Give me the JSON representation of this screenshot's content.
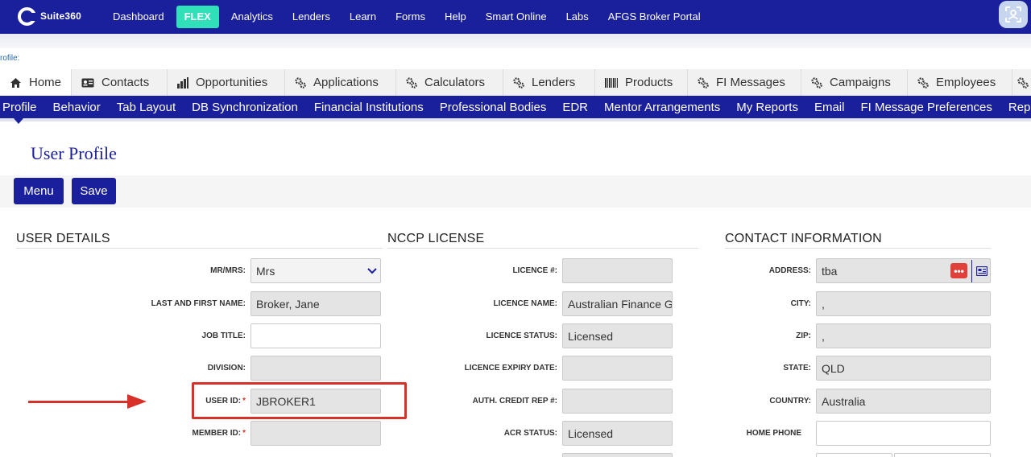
{
  "app": {
    "logo_text": "Suite360"
  },
  "topnav": {
    "items": [
      "Dashboard",
      "FLEX",
      "Analytics",
      "Lenders",
      "Learn",
      "Forms",
      "Help",
      "Smart Online",
      "Labs",
      "AFGS Broker Portal"
    ],
    "active": "FLEX"
  },
  "breadcrumb": "rofile:",
  "module_tabs": [
    {
      "label": "Home",
      "icon": "home-icon"
    },
    {
      "label": "Contacts",
      "icon": "contact-card-icon"
    },
    {
      "label": "Opportunities",
      "icon": "bar-chart-icon"
    },
    {
      "label": "Applications",
      "icon": "cogs-icon"
    },
    {
      "label": "Calculators",
      "icon": "cogs-icon"
    },
    {
      "label": "Lenders",
      "icon": "cogs-icon"
    },
    {
      "label": "Products",
      "icon": "barcode-icon"
    },
    {
      "label": "FI Messages",
      "icon": "cogs-icon"
    },
    {
      "label": "Campaigns",
      "icon": "cogs-icon"
    },
    {
      "label": "Employees",
      "icon": "cogs-icon"
    }
  ],
  "sub_tabs": [
    "Profile",
    "Behavior",
    "Tab Layout",
    "DB Synchronization",
    "Financial Institutions",
    "Professional Bodies",
    "EDR",
    "Mentor Arrangements",
    "My Reports",
    "Email",
    "FI Message Preferences",
    "Report"
  ],
  "page": {
    "title": "User Profile",
    "menu_label": "Menu",
    "save_label": "Save"
  },
  "user_details": {
    "title": "USER DETAILS",
    "mr_mrs_label": "MR/MRS:",
    "mr_mrs_value": "Mrs",
    "name_label": "LAST AND FIRST NAME:",
    "name_value": "Broker, Jane",
    "job_title_label": "JOB TITLE:",
    "job_title_value": "",
    "division_label": "DIVISION:",
    "division_value": "",
    "user_id_label": "USER ID:",
    "user_id_value": "JBROKER1",
    "member_id_label": "MEMBER ID:",
    "member_id_value": "",
    "required_mark": "*"
  },
  "nccp": {
    "title": "NCCP LICENSE",
    "licence_no_label": "LICENCE #:",
    "licence_no_value": "",
    "licence_name_label": "LICENCE NAME:",
    "licence_name_value": "Australian Finance G",
    "licence_status_label": "LICENCE STATUS:",
    "licence_status_value": "Licensed",
    "licence_expiry_label": "LICENCE EXPIRY DATE:",
    "licence_expiry_value": "",
    "auth_credit_label": "AUTH. CREDIT REP #:",
    "auth_credit_value": "",
    "acr_status_label": "ACR STATUS:",
    "acr_status_value": "Licensed"
  },
  "contact": {
    "title": "CONTACT INFORMATION",
    "address_label": "ADDRESS:",
    "address_value": "tba",
    "address_more": "•••",
    "city_label": "CITY:",
    "city_value": ",",
    "zip_label": "ZIP:",
    "zip_value": ",",
    "state_label": "STATE:",
    "state_value": "QLD",
    "country_label": "COUNTRY:",
    "country_value": "Australia",
    "home_phone_label": "HOME PHONE",
    "home_phone_value": ""
  },
  "colors": {
    "brand": "#1a1f9c",
    "active_tab": "#2fe0b8",
    "highlight": "#d8312a"
  }
}
